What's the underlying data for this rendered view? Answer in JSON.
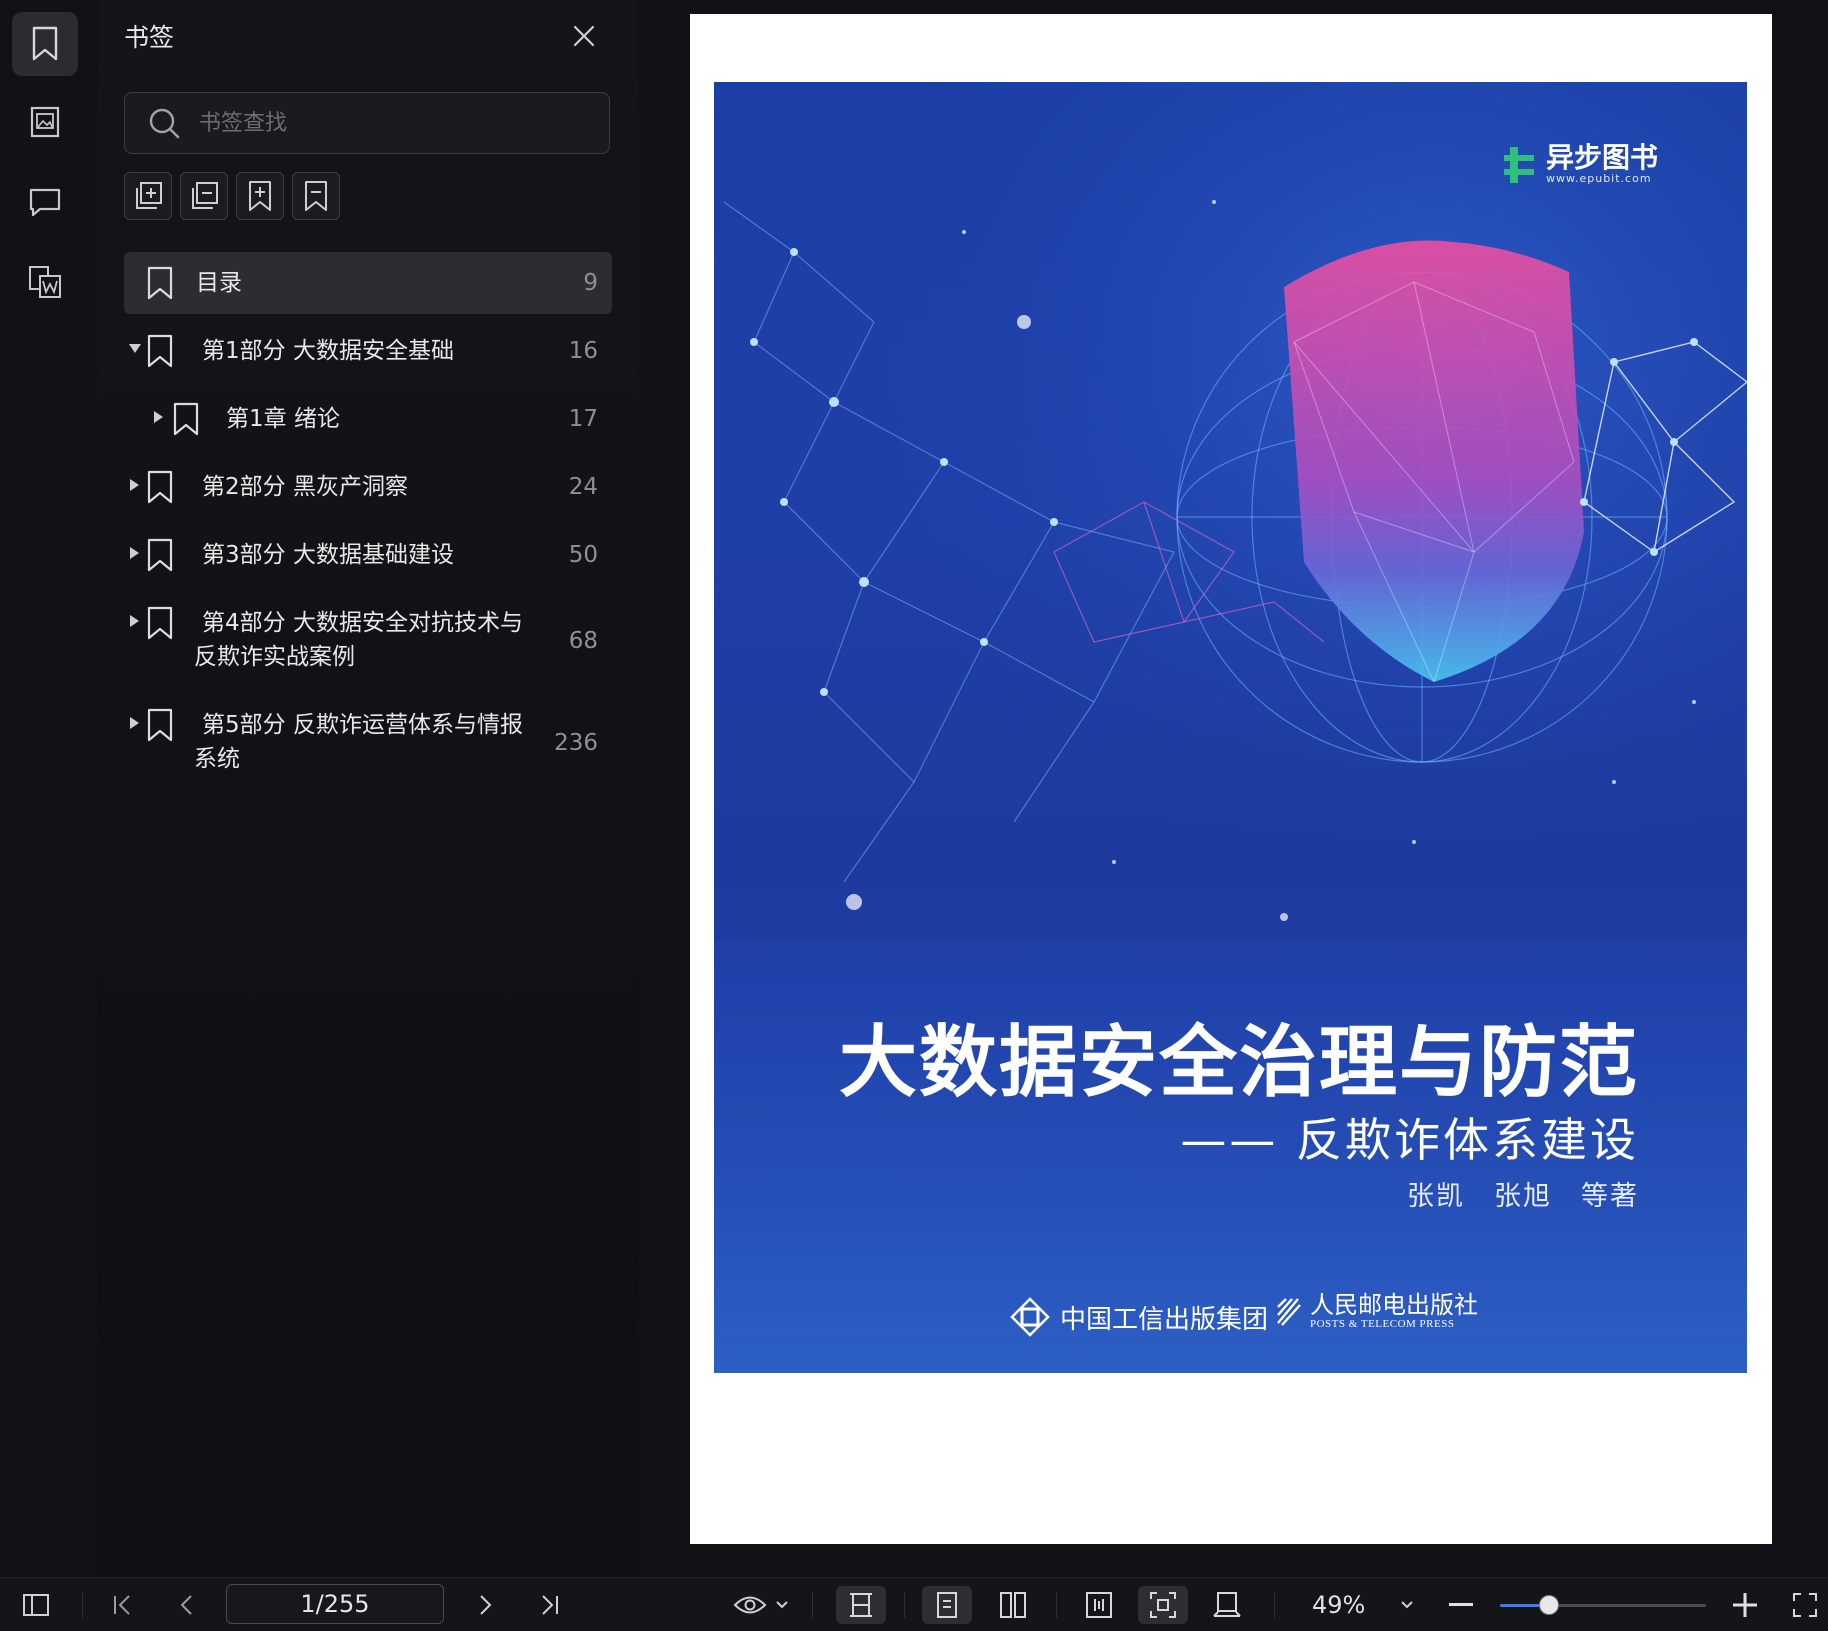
{
  "rail": {
    "items": [
      {
        "name": "bookmark-icon",
        "active": true
      },
      {
        "name": "thumbnail-icon",
        "active": false
      },
      {
        "name": "comment-icon",
        "active": false
      },
      {
        "name": "word-convert-icon",
        "active": false
      }
    ]
  },
  "panel": {
    "title": "书签",
    "search_placeholder": "书签查找",
    "tools": [
      "add-bookmark-icon",
      "remove-bookmark-icon",
      "bookmark-plus-icon",
      "bookmark-minus-icon"
    ],
    "bookmarks": [
      {
        "label": "目录",
        "page": "9",
        "level": 0,
        "has_children": false,
        "expanded": false,
        "selected": true
      },
      {
        "label": "第1部分 大数据安全基础",
        "page": "16",
        "level": 0,
        "has_children": true,
        "expanded": true,
        "selected": false
      },
      {
        "label": "第1章 绪论",
        "page": "17",
        "level": 1,
        "has_children": true,
        "expanded": false,
        "selected": false
      },
      {
        "label": "第2部分 黑灰产洞察",
        "page": "24",
        "level": 0,
        "has_children": true,
        "expanded": false,
        "selected": false
      },
      {
        "label": "第3部分 大数据基础建设",
        "page": "50",
        "level": 0,
        "has_children": true,
        "expanded": false,
        "selected": false
      },
      {
        "label": "第4部分 大数据安全对抗技术与",
        "label2": "反欺诈实战案例",
        "page": "68",
        "level": 0,
        "has_children": true,
        "expanded": false,
        "selected": false
      },
      {
        "label": "第5部分 反欺诈运营体系与情报",
        "label2": "系统",
        "page": "236",
        "level": 0,
        "has_children": true,
        "expanded": false,
        "selected": false
      }
    ]
  },
  "cover": {
    "brand_zh": "异步图书",
    "brand_en": "www.epubit.com",
    "title": "大数据安全治理与防范",
    "subtitle": "—— 反欺诈体系建设",
    "authors": "张凯　张旭　等著",
    "publisher1": "中国工信出版集团",
    "publisher2_zh": "人民邮电出版社",
    "publisher2_en": "POSTS & TELECOM PRESS"
  },
  "toolbar": {
    "page_value": "1/255",
    "zoom": "49%",
    "zoom_fraction": 0.24,
    "accent": "#3d7cf5"
  }
}
